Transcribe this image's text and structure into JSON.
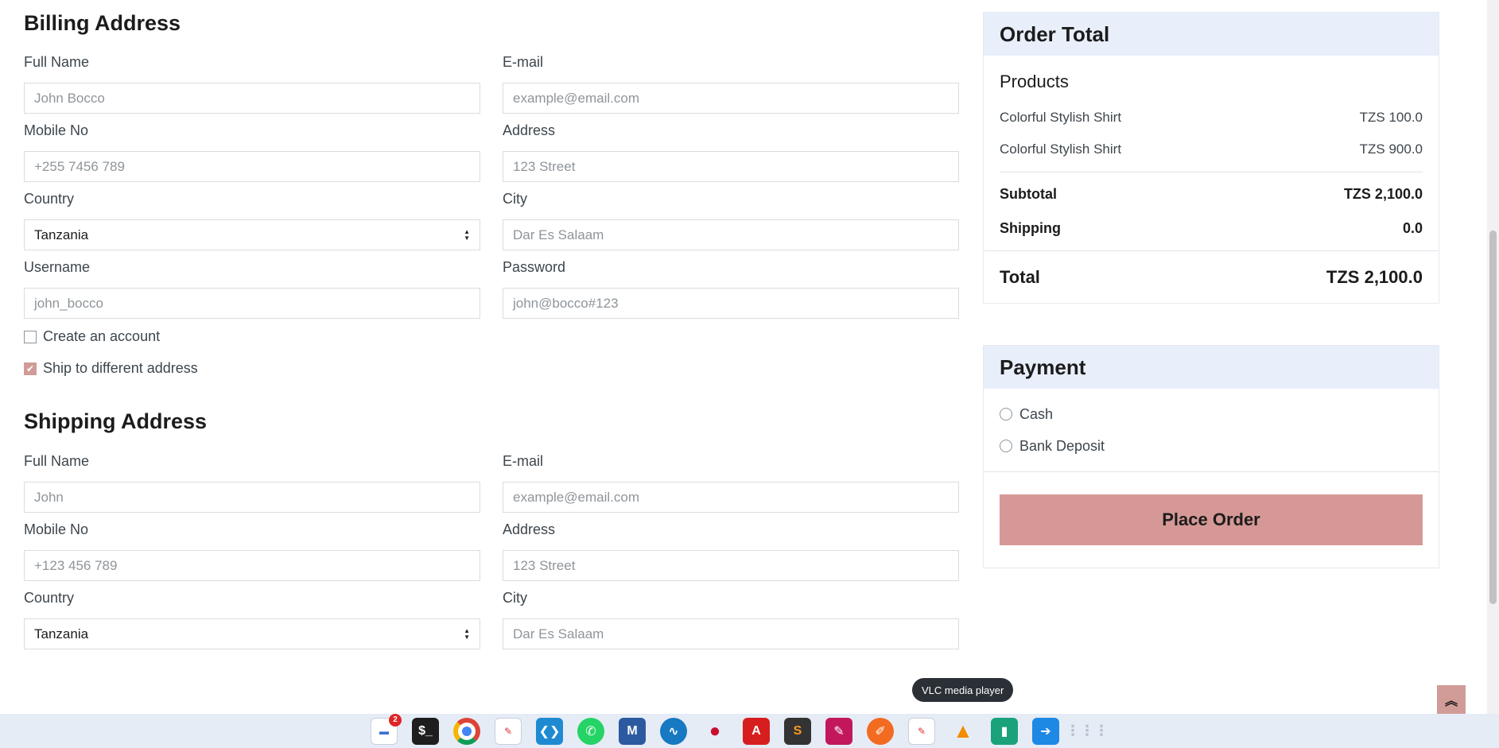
{
  "billing": {
    "title": "Billing Address",
    "full_name": {
      "label": "Full Name",
      "placeholder": "John Bocco"
    },
    "email": {
      "label": "E-mail",
      "placeholder": "example@email.com"
    },
    "mobile": {
      "label": "Mobile No",
      "placeholder": "+255 7456 789"
    },
    "address": {
      "label": "Address",
      "placeholder": "123 Street"
    },
    "country": {
      "label": "Country",
      "value": "Tanzania"
    },
    "city": {
      "label": "City",
      "placeholder": "Dar Es Salaam"
    },
    "username": {
      "label": "Username",
      "placeholder": "john_bocco"
    },
    "password": {
      "label": "Password",
      "placeholder": "john@bocco#123"
    },
    "create_account": {
      "label": "Create an account",
      "checked": false
    },
    "ship_different": {
      "label": "Ship to different address",
      "checked": true
    }
  },
  "shipping": {
    "title": "Shipping Address",
    "full_name": {
      "label": "Full Name",
      "placeholder": "John"
    },
    "email": {
      "label": "E-mail",
      "placeholder": "example@email.com"
    },
    "mobile": {
      "label": "Mobile No",
      "placeholder": "+123 456 789"
    },
    "address": {
      "label": "Address",
      "placeholder": "123 Street"
    },
    "country": {
      "label": "Country",
      "value": "Tanzania"
    },
    "city": {
      "label": "City",
      "placeholder": "Dar Es Salaam"
    }
  },
  "order": {
    "title": "Order Total",
    "products_title": "Products",
    "products": [
      {
        "name": "Colorful Stylish Shirt",
        "price": "TZS 100.0"
      },
      {
        "name": "Colorful Stylish Shirt",
        "price": "TZS 900.0"
      }
    ],
    "subtotal_label": "Subtotal",
    "subtotal_value": "TZS 2,100.0",
    "shipping_label": "Shipping",
    "shipping_value": "0.0",
    "total_label": "Total",
    "total_value": "TZS 2,100.0"
  },
  "payment": {
    "title": "Payment",
    "options": [
      "Cash",
      "Bank Deposit"
    ],
    "place_order": "Place Order"
  },
  "tooltip": "VLC media player",
  "taskbar": {
    "badge_count": "2",
    "apps": [
      "calendar-icon",
      "terminal-icon",
      "chrome-icon",
      "text-editor-icon",
      "vscode-icon",
      "whatsapp-icon",
      "metasploit-icon",
      "wireshark-icon",
      "cherry-icon",
      "pdf-reader-icon",
      "sublime-icon",
      "file-icon",
      "pen-tool-icon",
      "document-icon",
      "vlc-icon",
      "archive-icon",
      "share-icon",
      "apps-grid-icon"
    ]
  },
  "colors": {
    "accent": "#d19c97",
    "card_header": "#e8effb",
    "taskbar": "#e6ecf6"
  }
}
